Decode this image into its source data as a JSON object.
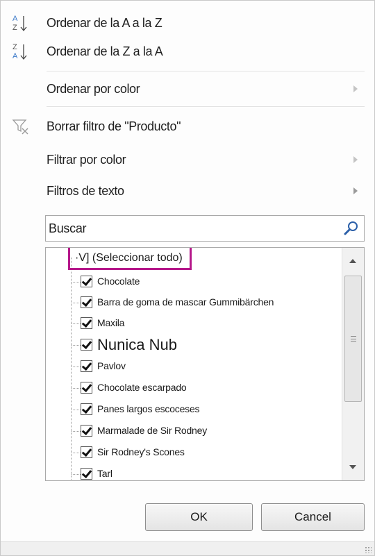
{
  "menu": {
    "sort_az": "Ordenar de la A a la Z",
    "sort_za": "Ordenar de la Z a la A",
    "sort_by_color": "Ordenar por color",
    "clear_filter": "Borrar filtro de \"Producto\"",
    "filter_by_color": "Filtrar por color",
    "text_filters": "Filtros de texto"
  },
  "search": {
    "placeholder": "Buscar"
  },
  "list": {
    "select_all": "·V] (Seleccionar todo)",
    "items": [
      "Chocolate",
      "Barra de goma de mascar Gummibärchen",
      "Maxila",
      "Nunica Nub",
      "Pavlov",
      "Chocolate escarpado",
      "Panes largos escoceses",
      "Marmalade de Sir Rodney",
      "Sir Rodney's Scones",
      "Tarl"
    ]
  },
  "buttons": {
    "ok": "OK",
    "cancel": "Cancel"
  },
  "colors": {
    "highlight_marker": "#b5178a",
    "sort_icon_blue": "#3a78c8"
  }
}
